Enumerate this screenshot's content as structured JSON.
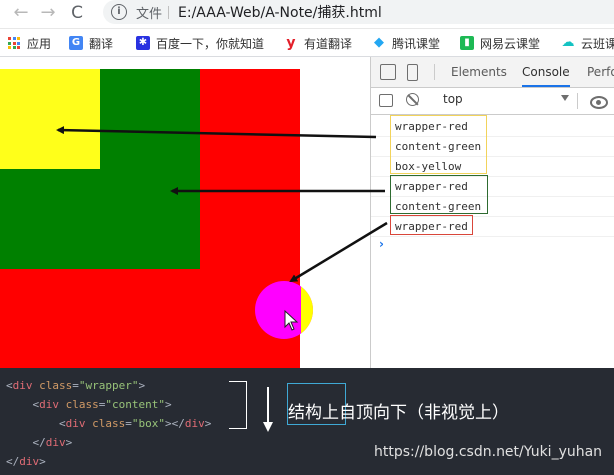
{
  "browser": {
    "file_label": "文件",
    "url": "E:/AAA-Web/A-Note/捕获.html",
    "back": "←",
    "forward": "→",
    "reload": "C",
    "info": "i"
  },
  "bookmarks": [
    {
      "label": "应用",
      "icon": "apps-grid-icon"
    },
    {
      "label": "翻译",
      "icon": "google-translate-icon",
      "color": "#4285f4",
      "glyph": "G"
    },
    {
      "label": "百度一下，你就知道",
      "icon": "baidu-paw-icon",
      "color": "#2932e1",
      "glyph": "✱"
    },
    {
      "label": "有道翻译",
      "icon": "youdao-icon",
      "color": "#e31f2a",
      "glyph": "y"
    },
    {
      "label": "腾讯课堂",
      "icon": "tencent-classroom-icon",
      "color": "#23a7f2",
      "glyph": "◆"
    },
    {
      "label": "网易云课堂",
      "icon": "netease-classroom-icon",
      "color": "#1db954",
      "glyph": "▮"
    },
    {
      "label": "云班课",
      "icon": "cloud-class-icon",
      "color": "#13c2c2",
      "glyph": "☁"
    }
  ],
  "devtools": {
    "tabs": [
      "Elements",
      "Console",
      "Perfo"
    ],
    "active_tab": "Console",
    "context": "top",
    "prompt": "›",
    "logs": [
      {
        "text": "wrapper-red"
      },
      {
        "text": "content-green"
      },
      {
        "text": "box-yellow"
      },
      {
        "text": "wrapper-red"
      },
      {
        "text": "content-green"
      },
      {
        "text": "wrapper-red"
      }
    ]
  },
  "colors": {
    "wrapper": "#ff0000",
    "content": "#008000",
    "box": "#ffff1a",
    "highlight_yellow": "#f5d84a",
    "highlight_green": "#2e7d32",
    "highlight_red": "#d32f2f"
  },
  "code": {
    "lines": [
      {
        "indent": "",
        "open": "<",
        "tag": "div",
        "attr": " class",
        "eq": "=",
        "val": "\"wrapper\"",
        "close": ">"
      },
      {
        "indent": "    ",
        "open": "<",
        "tag": "div",
        "attr": " class",
        "eq": "=",
        "val": "\"content\"",
        "close": ">"
      },
      {
        "indent": "        ",
        "open": "<",
        "tag": "div",
        "attr": " class",
        "eq": "=",
        "val": "\"box\"",
        "close": "></",
        "tag2": "div",
        "end": ">"
      },
      {
        "indent": "    ",
        "open": "</",
        "tag": "div",
        "close": ">"
      },
      {
        "indent": "",
        "open": "</",
        "tag": "div",
        "close": ">"
      }
    ],
    "caption": "结构上自顶向下（非视觉上）",
    "watermark": "https://blog.csdn.net/Yuki_yuhan"
  }
}
